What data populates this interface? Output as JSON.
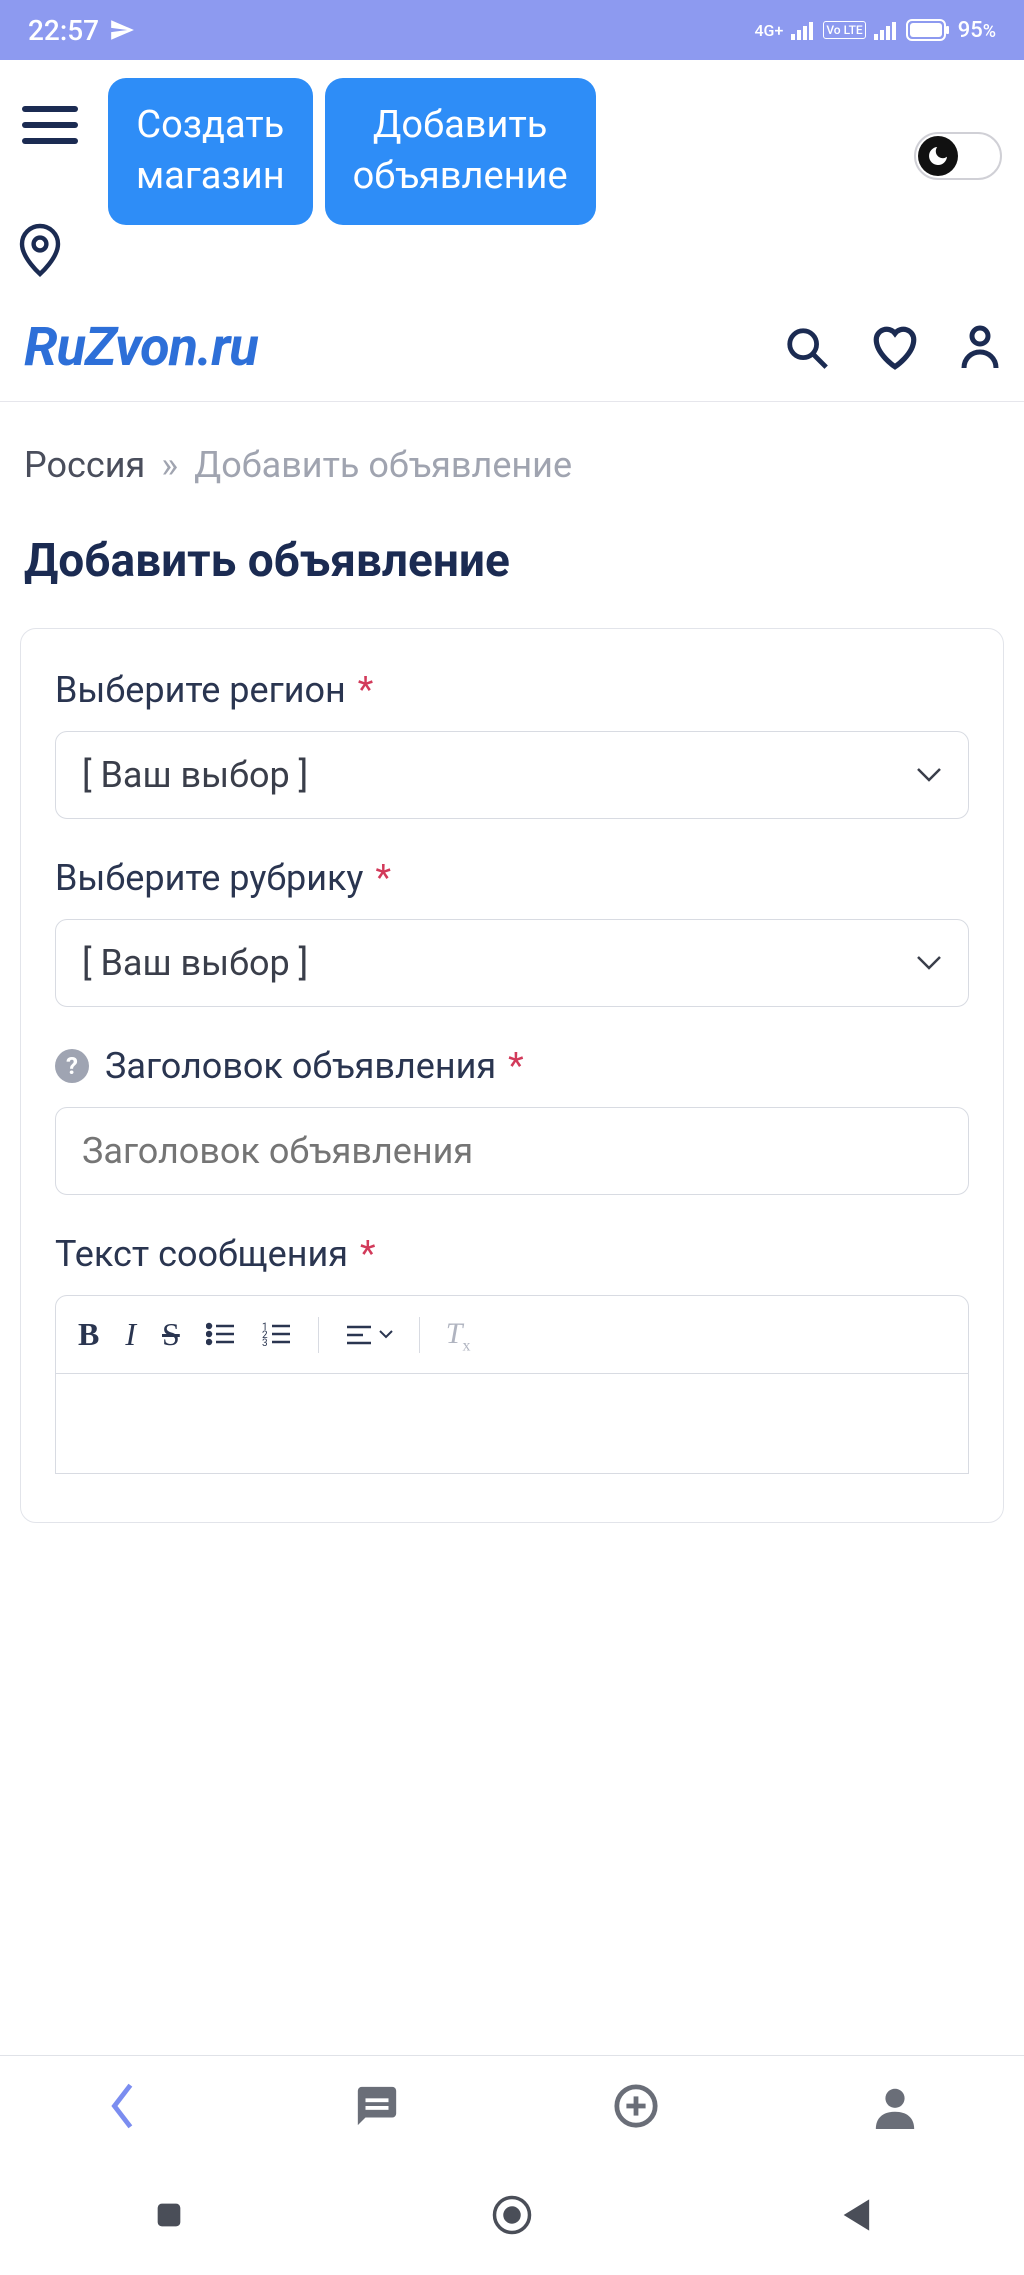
{
  "status": {
    "time": "22:57",
    "battery": "95",
    "net_label": "4G+",
    "volte": "Vo LTE"
  },
  "header": {
    "create_store_line1": "Создать",
    "create_store_line2": "магазин",
    "add_ad_line1": "Добавить",
    "add_ad_line2": "объявление"
  },
  "logo": "RuZvon.ru",
  "breadcrumb": {
    "root": "Россия",
    "sep": "»",
    "current": "Добавить объявление"
  },
  "page_title": "Добавить объявление",
  "form": {
    "region_label": "Выберите регион",
    "region_value": "[ Ваш выбор ]",
    "rubric_label": "Выберите рубрику",
    "rubric_value": "[ Ваш выбор ]",
    "title_label": "Заголовок объявления",
    "title_placeholder": "Заголовок объявления",
    "text_label": "Текст сообщения",
    "help_mark": "?",
    "req_mark": "*"
  },
  "toolbar": {
    "bold": "B",
    "italic": "I",
    "strike": "S",
    "clear": "T",
    "clear_sub": "x"
  }
}
